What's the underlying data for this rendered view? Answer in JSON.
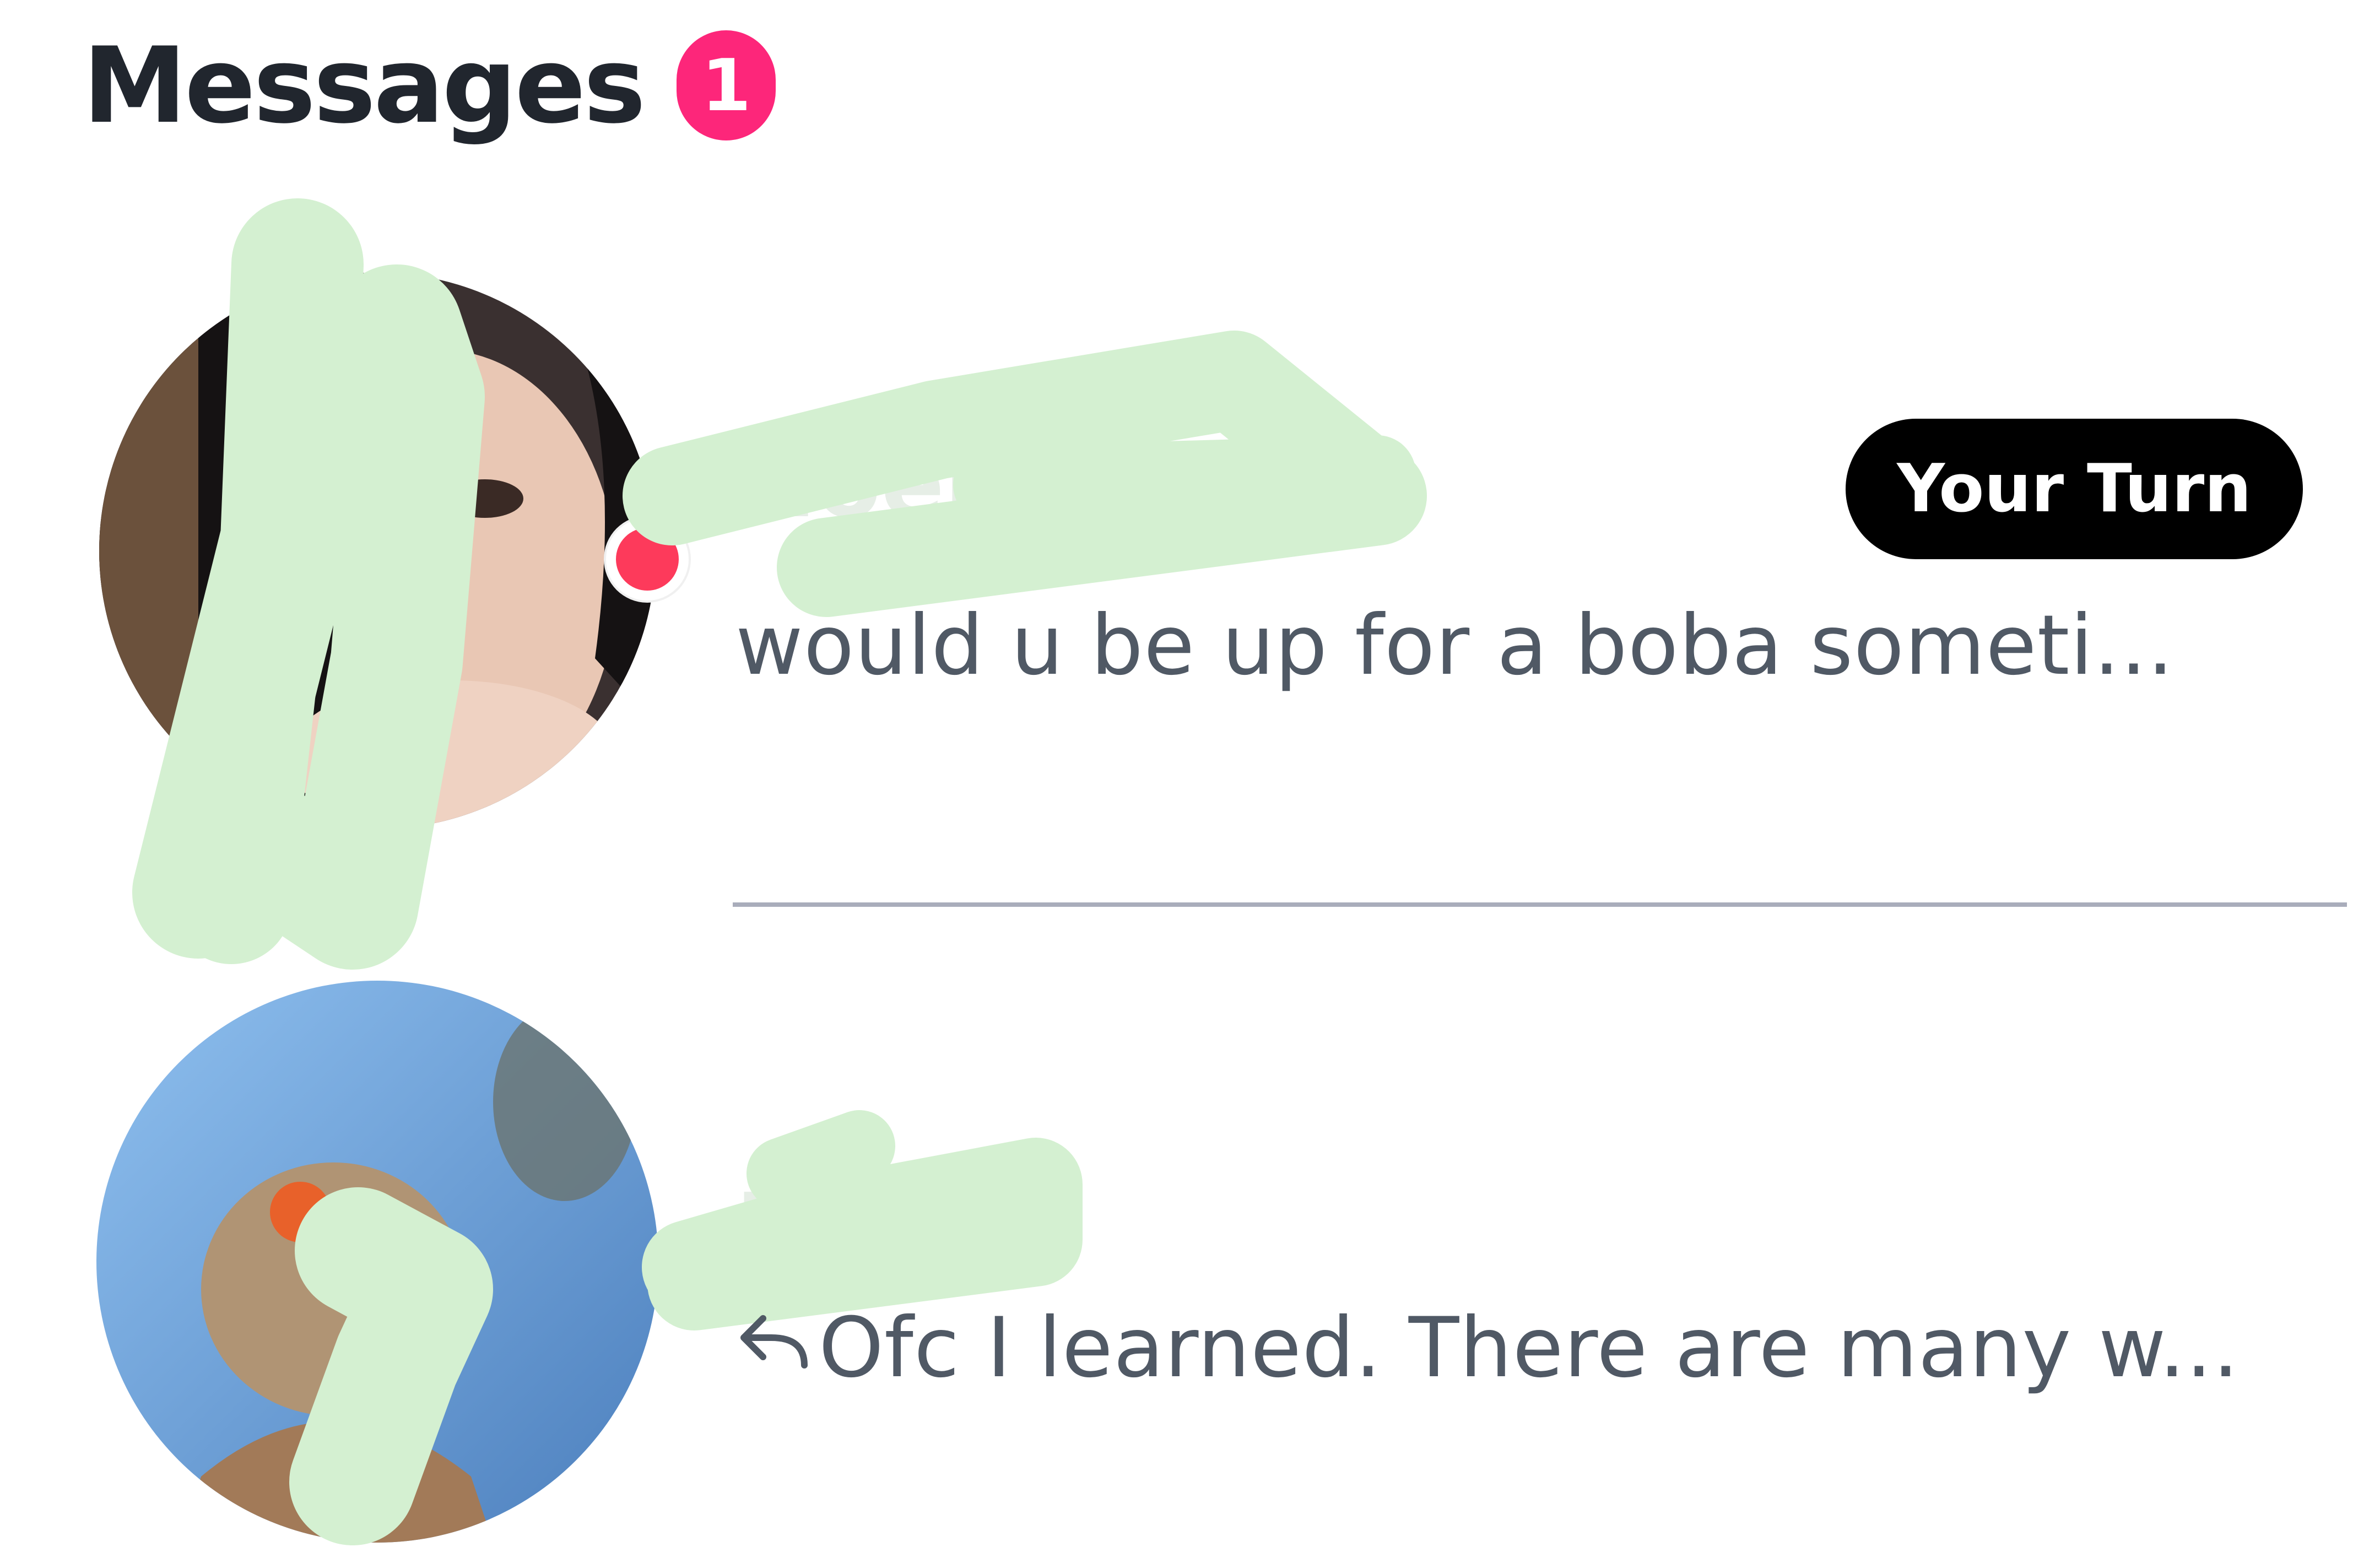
{
  "header": {
    "title": "Messages",
    "badge_count": "1"
  },
  "conversations": [
    {
      "name": "Noemi",
      "verified": true,
      "unread": true,
      "preview": "would u be up for a boba someti...",
      "tag": "Your Turn",
      "avatar_icon": "profile-photo"
    },
    {
      "name": "Julia",
      "verified": false,
      "unread": false,
      "replied": true,
      "preview": "Ofc I learned. There are many w...",
      "avatar_icon": "profile-photo"
    }
  ],
  "colors": {
    "badge": "#fd267a",
    "unread_dot": "#fd3a5b",
    "redaction": "#d4f0d1",
    "tag_bg": "#000000"
  }
}
